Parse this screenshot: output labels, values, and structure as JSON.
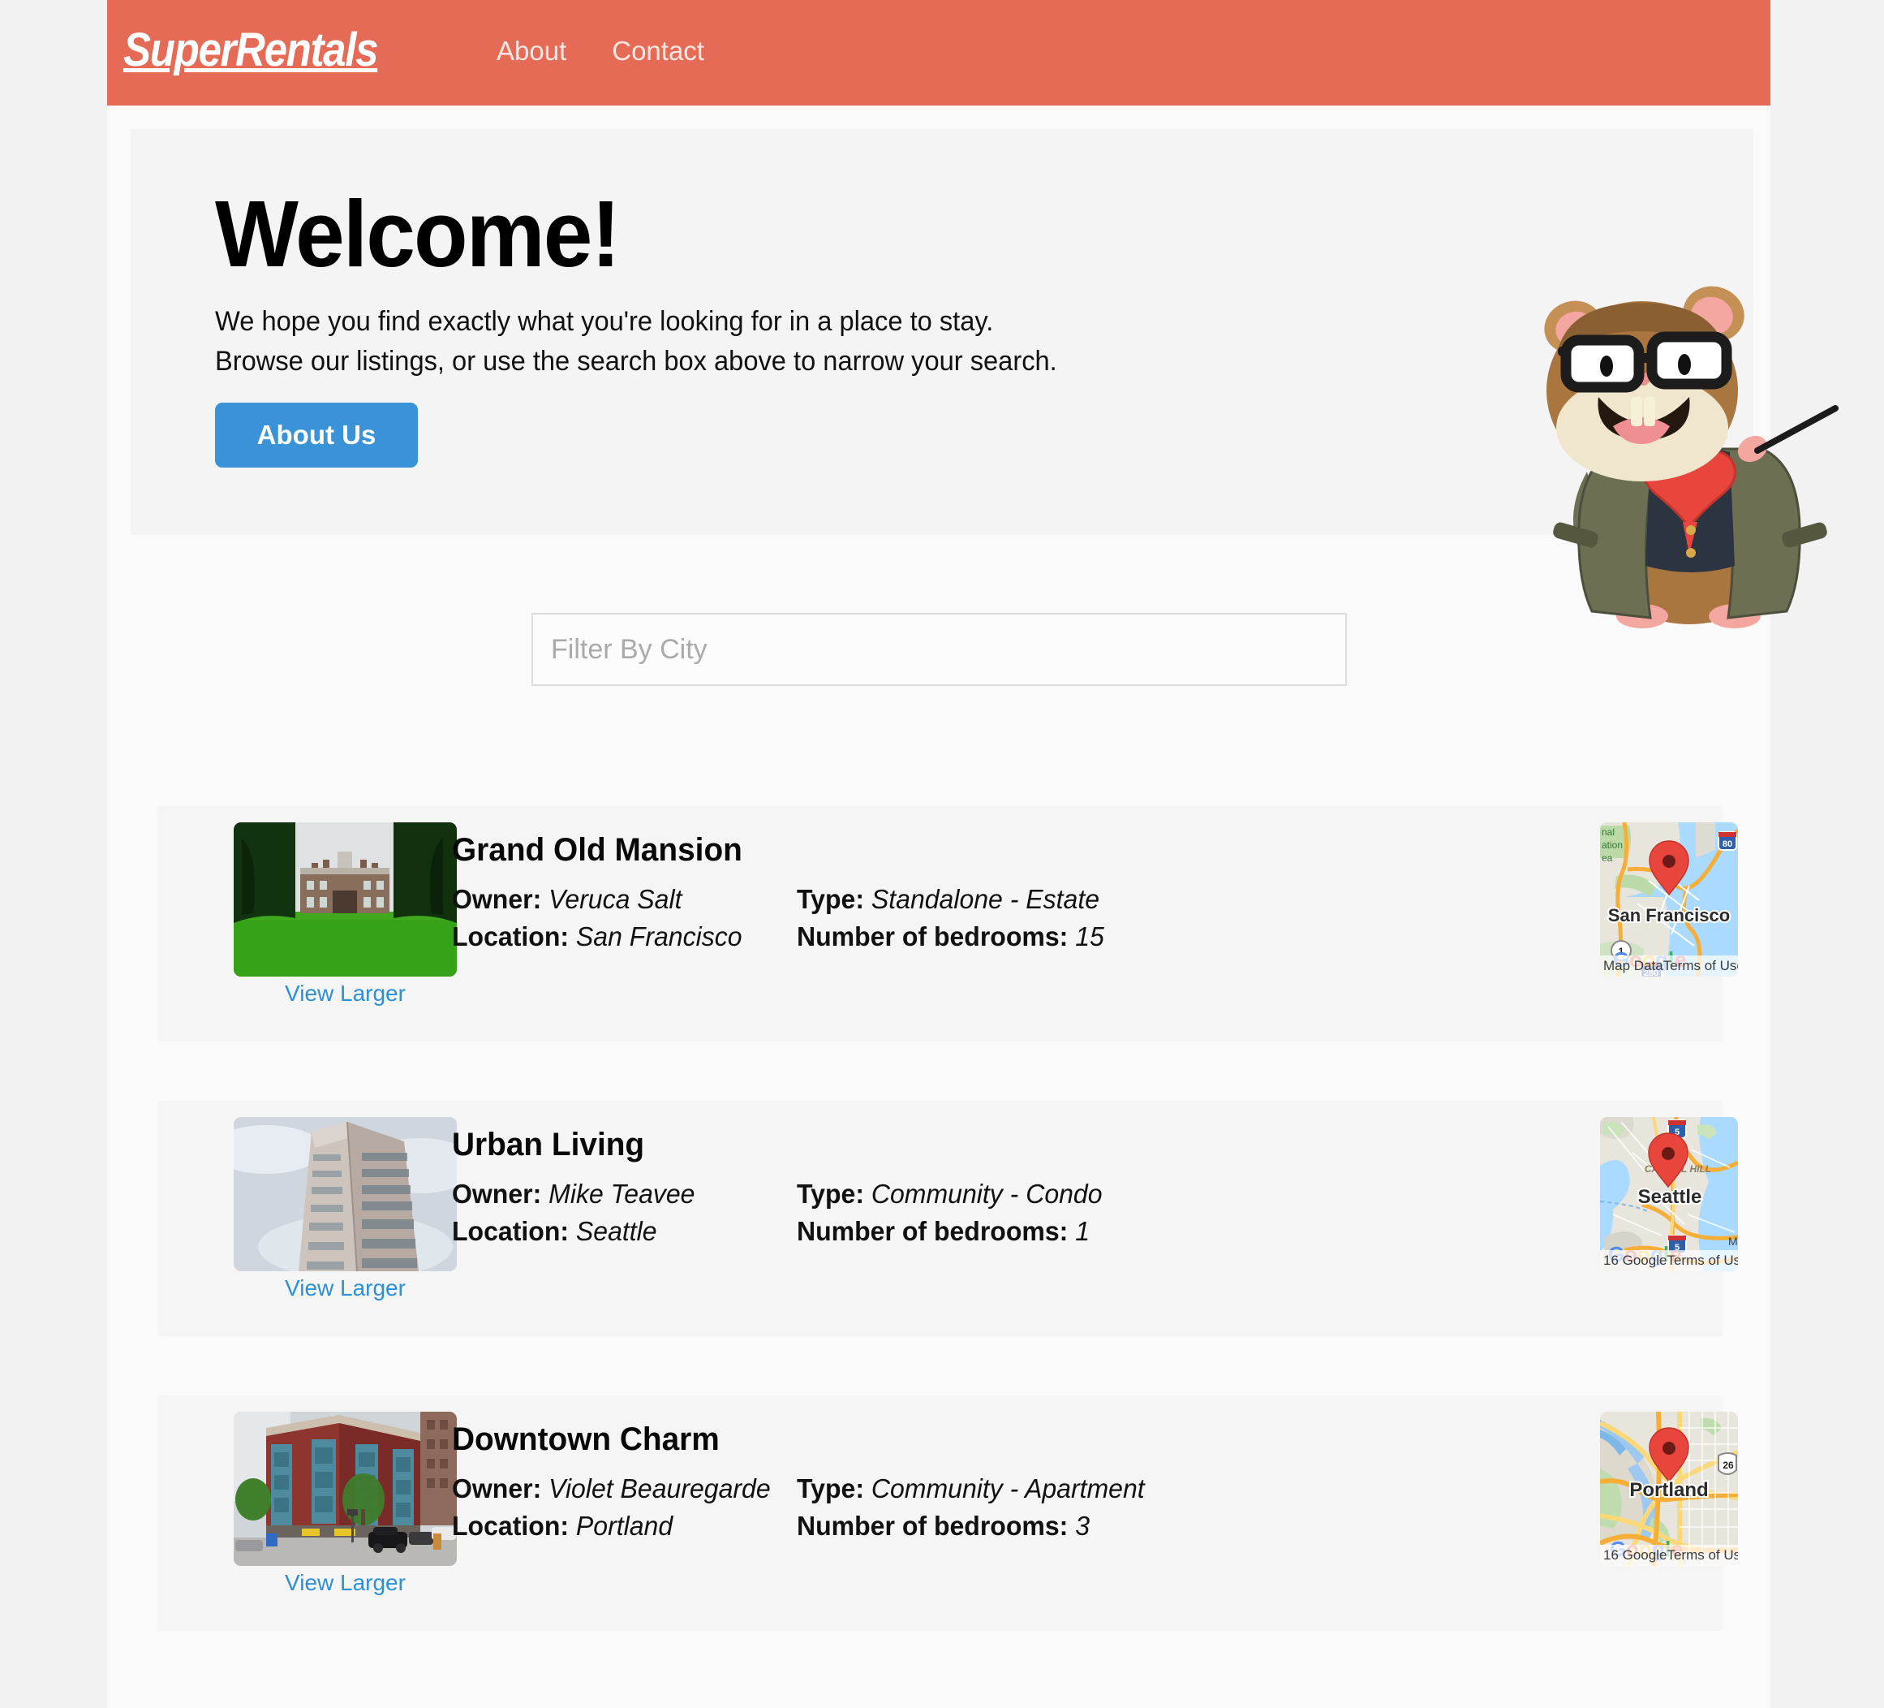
{
  "header": {
    "brand": "SuperRentals",
    "nav": [
      {
        "label": "About"
      },
      {
        "label": "Contact"
      }
    ],
    "bg_color": "#e66b56"
  },
  "jumbotron": {
    "title": "Welcome!",
    "subtitle_line1": "We hope you find exactly what you're looking for in a place to stay.",
    "subtitle_line2": "Browse our listings, or use the search box above to narrow your search.",
    "button_label": "About Us",
    "button_color": "#3a93d6",
    "mascot": "tomster-hamster-with-pointer"
  },
  "filter": {
    "placeholder": "Filter By City",
    "value": ""
  },
  "listings": [
    {
      "title": "Grand Old Mansion",
      "image_alt": "grand-old-mansion-photo",
      "view_larger_label": "View Larger",
      "owner_label": "Owner:",
      "owner": "Veruca Salt",
      "type_label": "Type:",
      "type": "Standalone - Estate",
      "location_label": "Location:",
      "location": "San Francisco",
      "bedrooms_label": "Number of bedrooms:",
      "bedrooms": "15",
      "map": {
        "city": "San Francisco",
        "attribution_left": "Map Data",
        "attribution_right": "Terms of Use",
        "labels": [
          "National Recreation Area"
        ],
        "shields": [
          "80",
          "1",
          "280"
        ]
      }
    },
    {
      "title": "Urban Living",
      "image_alt": "urban-high-rise-photo",
      "view_larger_label": "View Larger",
      "owner_label": "Owner:",
      "owner": "Mike Teavee",
      "type_label": "Type:",
      "type": "Community - Condo",
      "location_label": "Location:",
      "location": "Seattle",
      "bedrooms_label": "Number of bedrooms:",
      "bedrooms": "1",
      "map": {
        "city": "Seattle",
        "attribution_left": "16 Google",
        "attribution_right": "Terms of Use",
        "labels": [
          "CAPITOL HILL",
          "Me"
        ],
        "shields": [
          "5",
          "5"
        ]
      }
    },
    {
      "title": "Downtown Charm",
      "image_alt": "downtown-brick-apartment-photo",
      "view_larger_label": "View Larger",
      "owner_label": "Owner:",
      "owner": "Violet Beauregarde",
      "type_label": "Type:",
      "type": "Community - Apartment",
      "location_label": "Location:",
      "location": "Portland",
      "bedrooms_label": "Number of bedrooms:",
      "bedrooms": "3",
      "map": {
        "city": "Portland",
        "attribution_left": "16 Google",
        "attribution_right": "Terms of Use",
        "labels": [],
        "shields": [
          "26"
        ]
      }
    }
  ]
}
